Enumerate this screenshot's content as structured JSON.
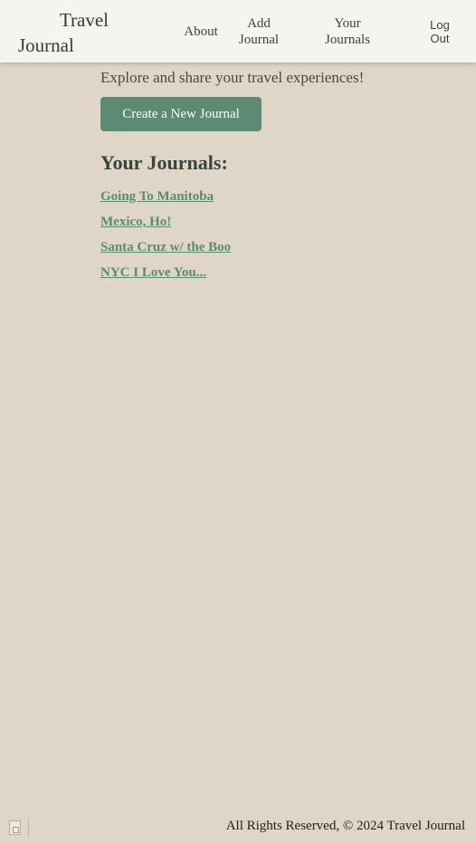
{
  "nav": {
    "brand_line1": "Travel",
    "brand_line2": "Journal",
    "about": "About",
    "add_line1": "Add",
    "add_line2": "Journal",
    "yours_line1": "Your",
    "yours_line2": "Journals",
    "logout_line1": "Log",
    "logout_line2": "Out"
  },
  "main": {
    "tagline": "Explore and share your travel experiences!",
    "create_button": "Create a New Journal",
    "journals_heading": "Your Journals:",
    "journals": [
      "Going To Manitoba",
      "Mexico, Ho!",
      "Santa Cruz w/ the Boo",
      "NYC I Love You..."
    ]
  },
  "footer": {
    "text": "All Rights Reserved, © 2024 Travel Journal",
    "icon": "page-icon"
  },
  "colors": {
    "background": "#e0d6c8",
    "navbar": "#f6f4ee",
    "accent": "#5c8a72",
    "text": "#36453d"
  }
}
